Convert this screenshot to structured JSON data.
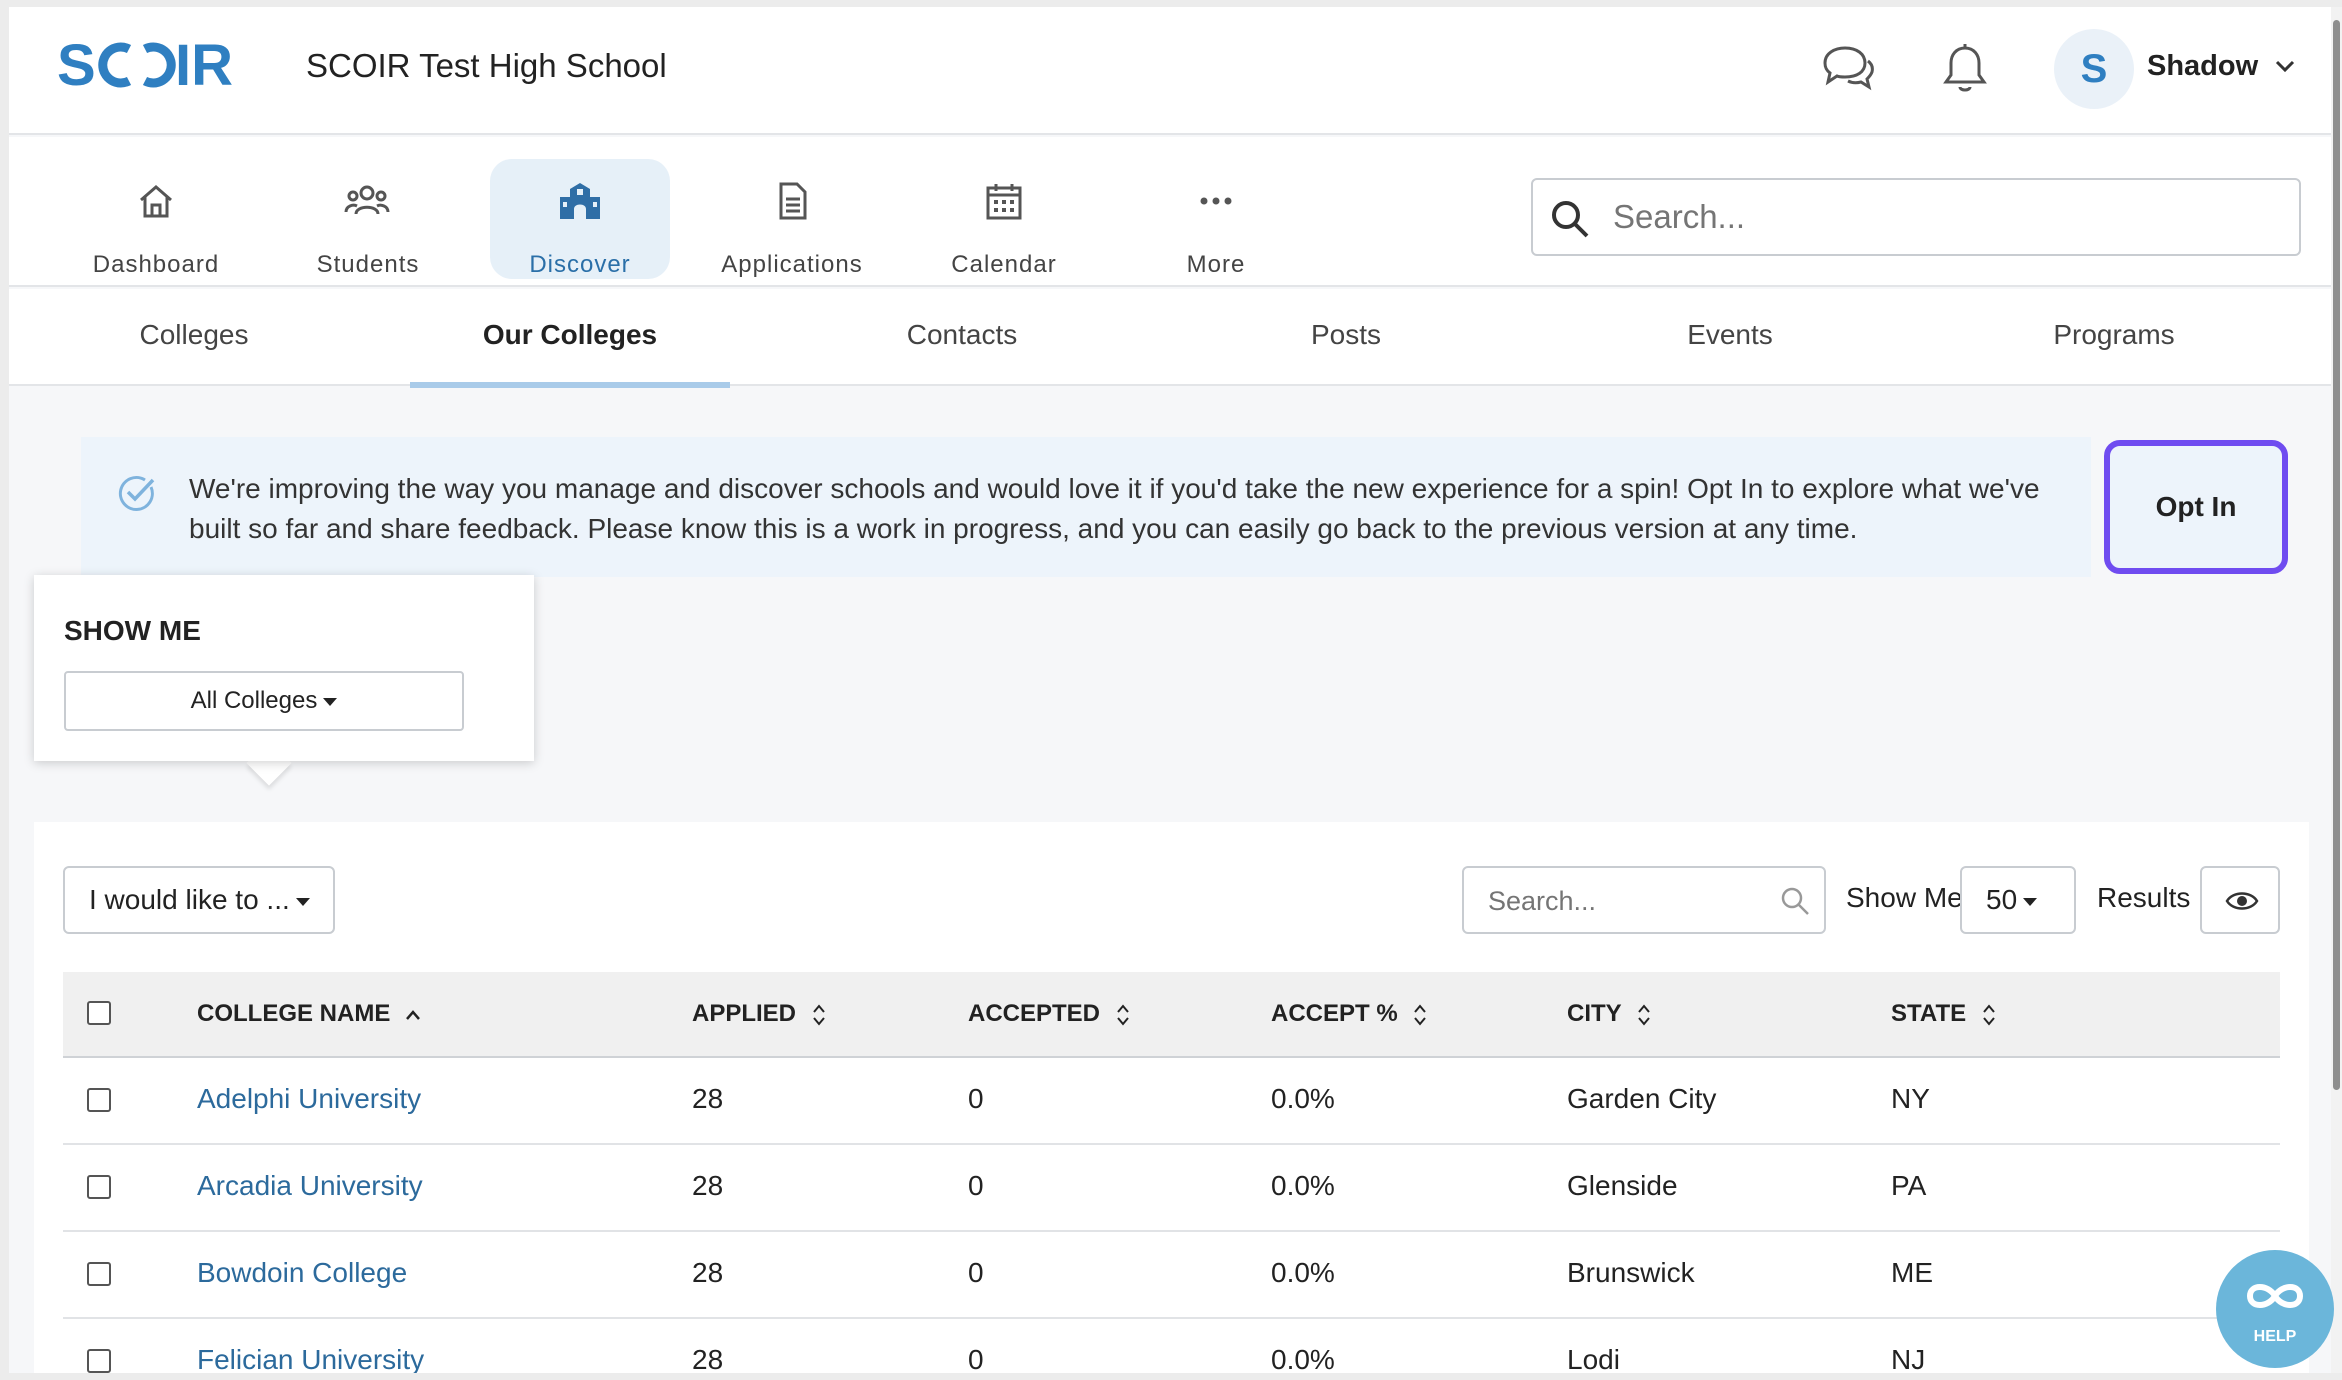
{
  "header": {
    "logo_text": "SCOIR",
    "school_name": "SCOIR Test High School",
    "avatar_initial": "S",
    "user_name": "Shadow"
  },
  "nav": {
    "items": [
      {
        "label": "Dashboard",
        "icon": "home-icon"
      },
      {
        "label": "Students",
        "icon": "users-icon"
      },
      {
        "label": "Discover",
        "icon": "school-icon",
        "active": true
      },
      {
        "label": "Applications",
        "icon": "document-icon"
      },
      {
        "label": "Calendar",
        "icon": "calendar-icon"
      },
      {
        "label": "More",
        "icon": "more-icon"
      }
    ],
    "search_placeholder": "Search..."
  },
  "tabs": [
    {
      "label": "Colleges"
    },
    {
      "label": "Our Colleges",
      "active": true
    },
    {
      "label": "Contacts"
    },
    {
      "label": "Posts"
    },
    {
      "label": "Events"
    },
    {
      "label": "Programs"
    }
  ],
  "banner": {
    "text": "We're improving the way you manage and discover schools and would love it if you'd take the new experience for a spin! Opt In to explore what we've built so far and share feedback. Please know this is a work in progress, and you can easily go back to the previous version at any time.",
    "button_label": "Opt In"
  },
  "show_me_popover": {
    "title": "SHOW ME",
    "selected": "All Colleges"
  },
  "toolbar": {
    "action_select": "I would like to ...",
    "search_placeholder": "Search...",
    "show_me_label": "Show Me",
    "page_size": "50",
    "results_label": "Results"
  },
  "table": {
    "columns": [
      "COLLEGE NAME",
      "APPLIED",
      "ACCEPTED",
      "ACCEPT %",
      "CITY",
      "STATE"
    ],
    "rows": [
      {
        "name": "Adelphi University",
        "applied": "28",
        "accepted": "0",
        "accept_pct": "0.0%",
        "city": "Garden City",
        "state": "NY"
      },
      {
        "name": "Arcadia University",
        "applied": "28",
        "accepted": "0",
        "accept_pct": "0.0%",
        "city": "Glenside",
        "state": "PA"
      },
      {
        "name": "Bowdoin College",
        "applied": "28",
        "accepted": "0",
        "accept_pct": "0.0%",
        "city": "Brunswick",
        "state": "ME"
      },
      {
        "name": "Felician University",
        "applied": "28",
        "accepted": "0",
        "accept_pct": "0.0%",
        "city": "Lodi",
        "state": "NJ"
      }
    ]
  },
  "help": {
    "label": "HELP"
  },
  "colors": {
    "brand": "#2f7fc1",
    "accent_purple": "#6f4cf0",
    "link": "#2c6a9c",
    "active_tab_underline": "#a9cbe9"
  }
}
